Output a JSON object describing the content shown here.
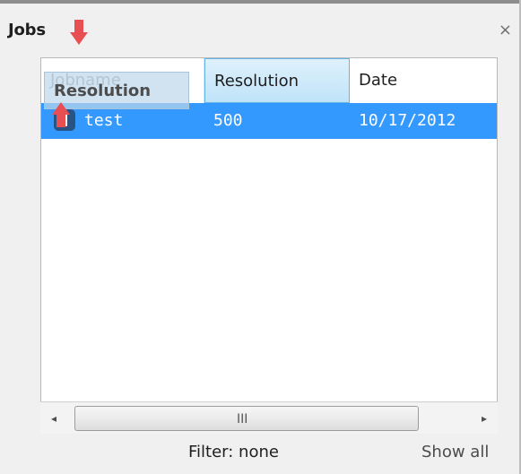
{
  "panel": {
    "title": "Jobs",
    "close_symbol": "×"
  },
  "table": {
    "columns": [
      "Jobname",
      "Resolution",
      "Date"
    ],
    "rows": [
      {
        "jobname": "test",
        "resolution": "500",
        "date": "10/17/2012"
      }
    ]
  },
  "drag": {
    "ghost_label": "Resolution"
  },
  "scrollbar": {
    "left_arrow": "◂",
    "right_arrow": "▸",
    "grip": "III"
  },
  "footer": {
    "filter_text": "Filter: none",
    "show_all_label": "Show all"
  },
  "colors": {
    "selection": "#3399ff",
    "drop_arrow": "#e84f52",
    "active_header": "#bfe3f8"
  }
}
